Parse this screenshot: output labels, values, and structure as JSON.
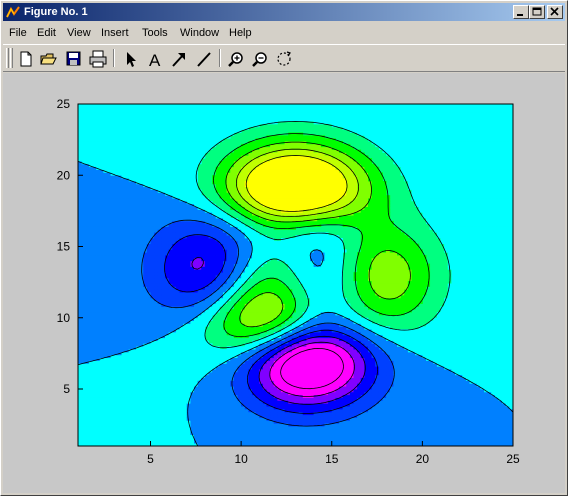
{
  "window": {
    "title": "Figure No. 1",
    "icon": "matlab-figure-icon",
    "controls": [
      "minimize-icon",
      "maximize-icon",
      "close-icon"
    ]
  },
  "menu": [
    "File",
    "Edit",
    "View",
    "Insert",
    "Tools",
    "Window",
    "Help"
  ],
  "toolbar": {
    "tools": [
      {
        "name": "new-figure",
        "icon": "new-file-icon"
      },
      {
        "name": "open-file",
        "icon": "open-folder-icon"
      },
      {
        "name": "save-figure",
        "icon": "save-disk-icon"
      },
      {
        "name": "print-figure",
        "icon": "printer-icon"
      },
      {
        "name": "edit-plot",
        "icon": "arrow-pointer-icon"
      },
      {
        "name": "insert-text",
        "icon": "text-A-icon"
      },
      {
        "name": "insert-arrow",
        "icon": "arrow-icon"
      },
      {
        "name": "insert-line",
        "icon": "line-icon"
      },
      {
        "name": "zoom-in",
        "icon": "zoom-in-icon"
      },
      {
        "name": "zoom-out",
        "icon": "zoom-out-icon"
      },
      {
        "name": "rotate-3d",
        "icon": "rotate-icon"
      }
    ]
  },
  "colors": {
    "figure_background": "#c8c8c8",
    "title_gradient_start": "#0a246a",
    "title_gradient_end": "#a6caf0"
  },
  "chart_data": {
    "type": "contourf",
    "function": "peaks(25)",
    "x": [
      1,
      25
    ],
    "y": [
      1,
      25
    ],
    "xlim": [
      1,
      25
    ],
    "ylim": [
      1,
      25
    ],
    "xticks": [
      5,
      10,
      15,
      20,
      25
    ],
    "yticks": [
      5,
      10,
      15,
      20,
      25
    ],
    "colormap": "hsv-like (magenta, blue, cyan, green, yellow)",
    "levels": [
      -5,
      -4,
      -3,
      -2,
      -1,
      0,
      1,
      2,
      3,
      4,
      5
    ],
    "level_colors": [
      "#ff00ff",
      "#8000ff",
      "#0000ff",
      "#0040ff",
      "#0080ff",
      "#00ffff",
      "#00ff80",
      "#00ff00",
      "#80ff00",
      "#c0ff00",
      "#ffff00"
    ],
    "grid": false,
    "title": "",
    "xlabel": "",
    "ylabel": ""
  }
}
